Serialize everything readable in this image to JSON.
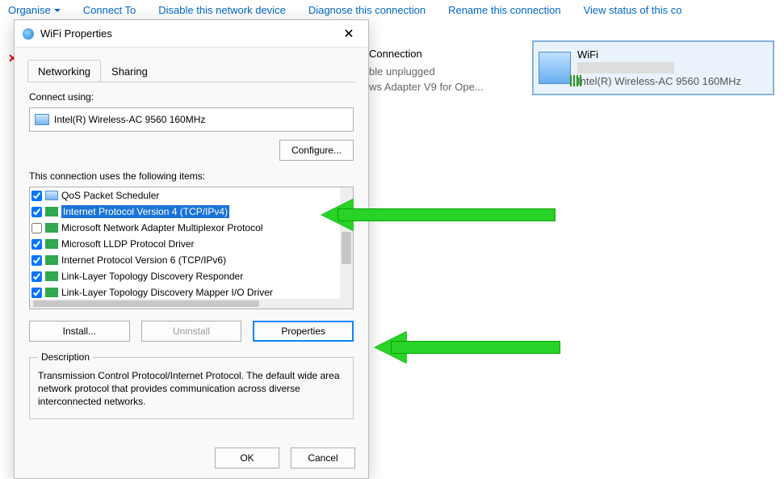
{
  "toolbar": {
    "organise": "Organise",
    "connect_to": "Connect To",
    "disable": "Disable this network device",
    "diagnose": "Diagnose this connection",
    "rename": "Rename this connection",
    "view_status": "View status of this co"
  },
  "bg": {
    "conn_title": "Connection",
    "sub1": "ble unplugged",
    "sub2": "ws Adapter V9 for Ope..."
  },
  "wifi_card": {
    "title": "WiFi",
    "subtitle": "Intel(R) Wireless-AC 9560 160MHz"
  },
  "dialog": {
    "title": "WiFi Properties",
    "tabs": {
      "networking": "Networking",
      "sharing": "Sharing"
    },
    "connect_using": "Connect using:",
    "adapter": "Intel(R) Wireless-AC 9560 160MHz",
    "configure": "Configure...",
    "items_label": "This connection uses the following items:",
    "items": [
      {
        "checked": true,
        "icon": "blue",
        "label": "QoS Packet Scheduler"
      },
      {
        "checked": true,
        "icon": "green",
        "label": "Internet Protocol Version 4 (TCP/IPv4)",
        "selected": true
      },
      {
        "checked": false,
        "icon": "green",
        "label": "Microsoft Network Adapter Multiplexor Protocol"
      },
      {
        "checked": true,
        "icon": "green",
        "label": "Microsoft LLDP Protocol Driver"
      },
      {
        "checked": true,
        "icon": "green",
        "label": "Internet Protocol Version 6 (TCP/IPv6)"
      },
      {
        "checked": true,
        "icon": "green",
        "label": "Link-Layer Topology Discovery Responder"
      },
      {
        "checked": true,
        "icon": "green",
        "label": "Link-Layer Topology Discovery Mapper I/O Driver"
      }
    ],
    "install": "Install...",
    "uninstall": "Uninstall",
    "properties": "Properties",
    "desc_legend": "Description",
    "desc_text": "Transmission Control Protocol/Internet Protocol. The default wide area network protocol that provides communication across diverse interconnected networks.",
    "ok": "OK",
    "cancel": "Cancel"
  }
}
